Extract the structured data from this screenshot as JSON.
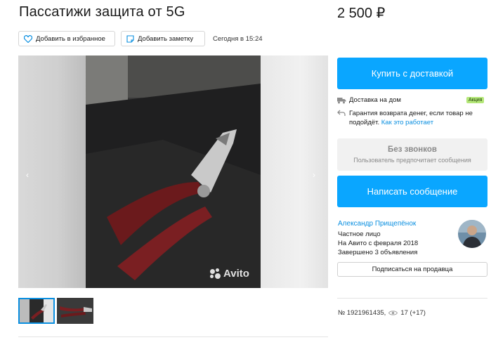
{
  "listing": {
    "title": "Пассатижи защита от 5G",
    "price": "2 500 ₽",
    "actions": {
      "favorite_label": "Добавить в избранное",
      "note_label": "Добавить заметку"
    },
    "posted": "Сегодня в 15:24"
  },
  "gallery": {
    "watermark": "Avito",
    "prev_arrow": "‹",
    "next_arrow": "›",
    "thumbnail_count": 2,
    "active_thumbnail": 1
  },
  "sidebar": {
    "buy_button": "Купить с доставкой",
    "delivery": {
      "label": "Доставка на дом",
      "badge": "Акция"
    },
    "return_policy": {
      "text": "Гарантия возврата денег, если товар не подойдёт.",
      "link": "Как это работает"
    },
    "no_calls": {
      "title": "Без звонков",
      "subtitle": "Пользователь предпочитает сообщения"
    },
    "message_button": "Написать сообщение",
    "seller": {
      "name": "Александр Прищепёнок",
      "type": "Частное лицо",
      "since": "На Авито с февраля 2018",
      "completed": "Завершено 3 объявления"
    },
    "subscribe_button": "Подписаться на продавца",
    "meta": {
      "ad_number": "№ 1921961435,",
      "views": "17 (+17)"
    }
  },
  "colors": {
    "accent": "#0aa6ff",
    "link": "#0a8fe0",
    "badge": "#b4e778"
  }
}
